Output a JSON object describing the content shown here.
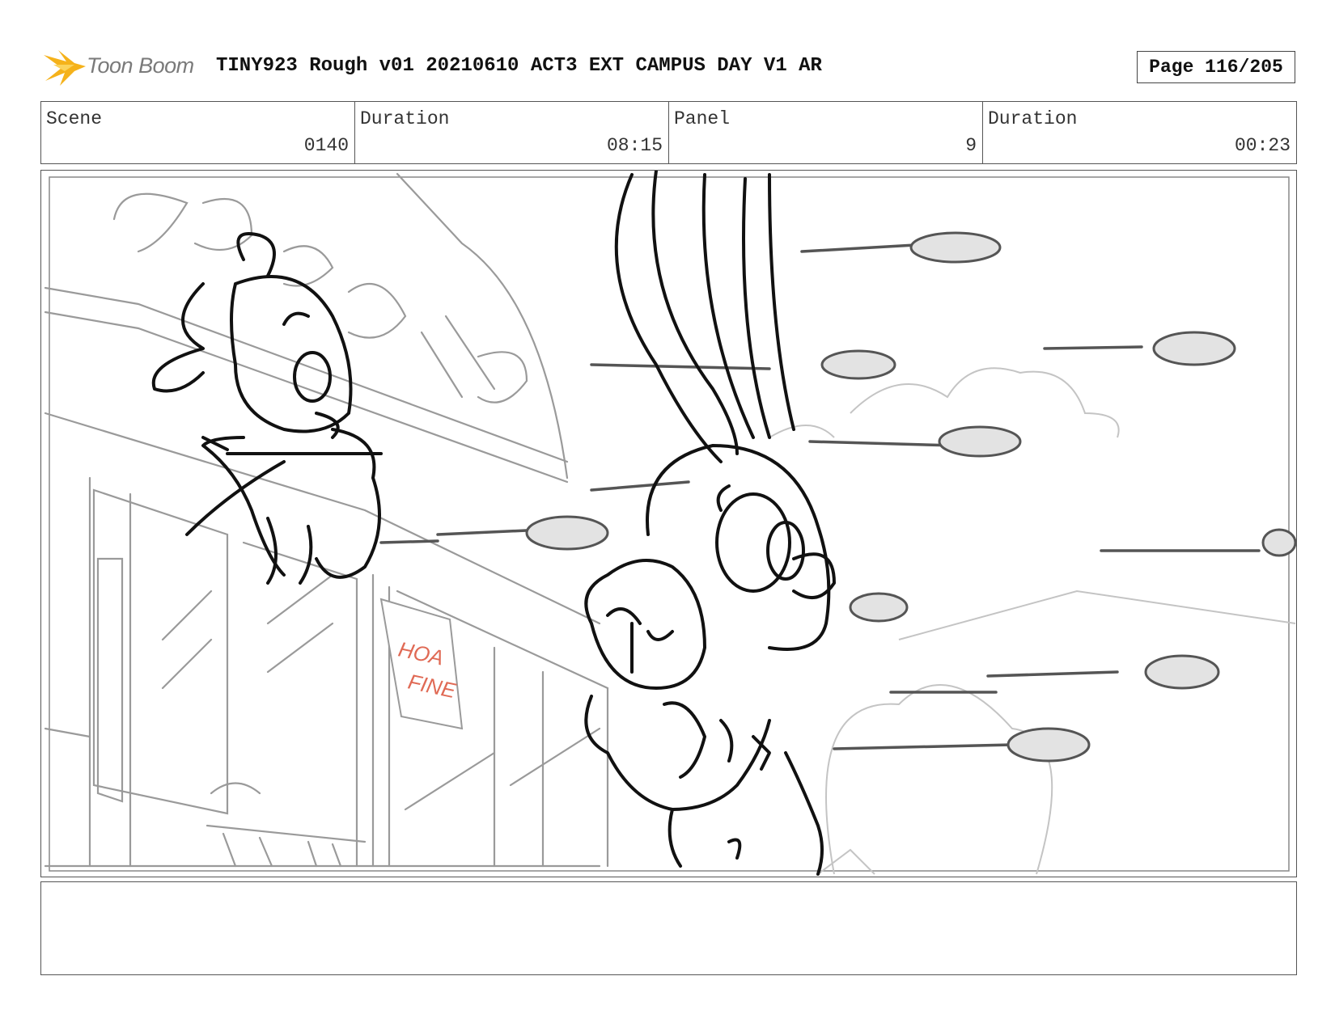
{
  "header": {
    "logo_text": "Toon Boom",
    "title": "TINY923 Rough v01 20210610 ACT3 EXT CAMPUS DAY V1 AR",
    "page": "Page 116/205"
  },
  "info": {
    "scene_label": "Scene",
    "scene_value": "0140",
    "duration_label": "Duration",
    "duration_value": "08:15",
    "panel_label": "Panel",
    "panel_value": "9",
    "panel_duration_label": "Duration",
    "panel_duration_value": "00:23"
  },
  "panel_sign": {
    "line1": "HOA",
    "line2": "FINE"
  },
  "notes": {
    "text": ""
  },
  "colors": {
    "logo_flame": "#f5b21b",
    "sign_text": "#e06a55"
  }
}
